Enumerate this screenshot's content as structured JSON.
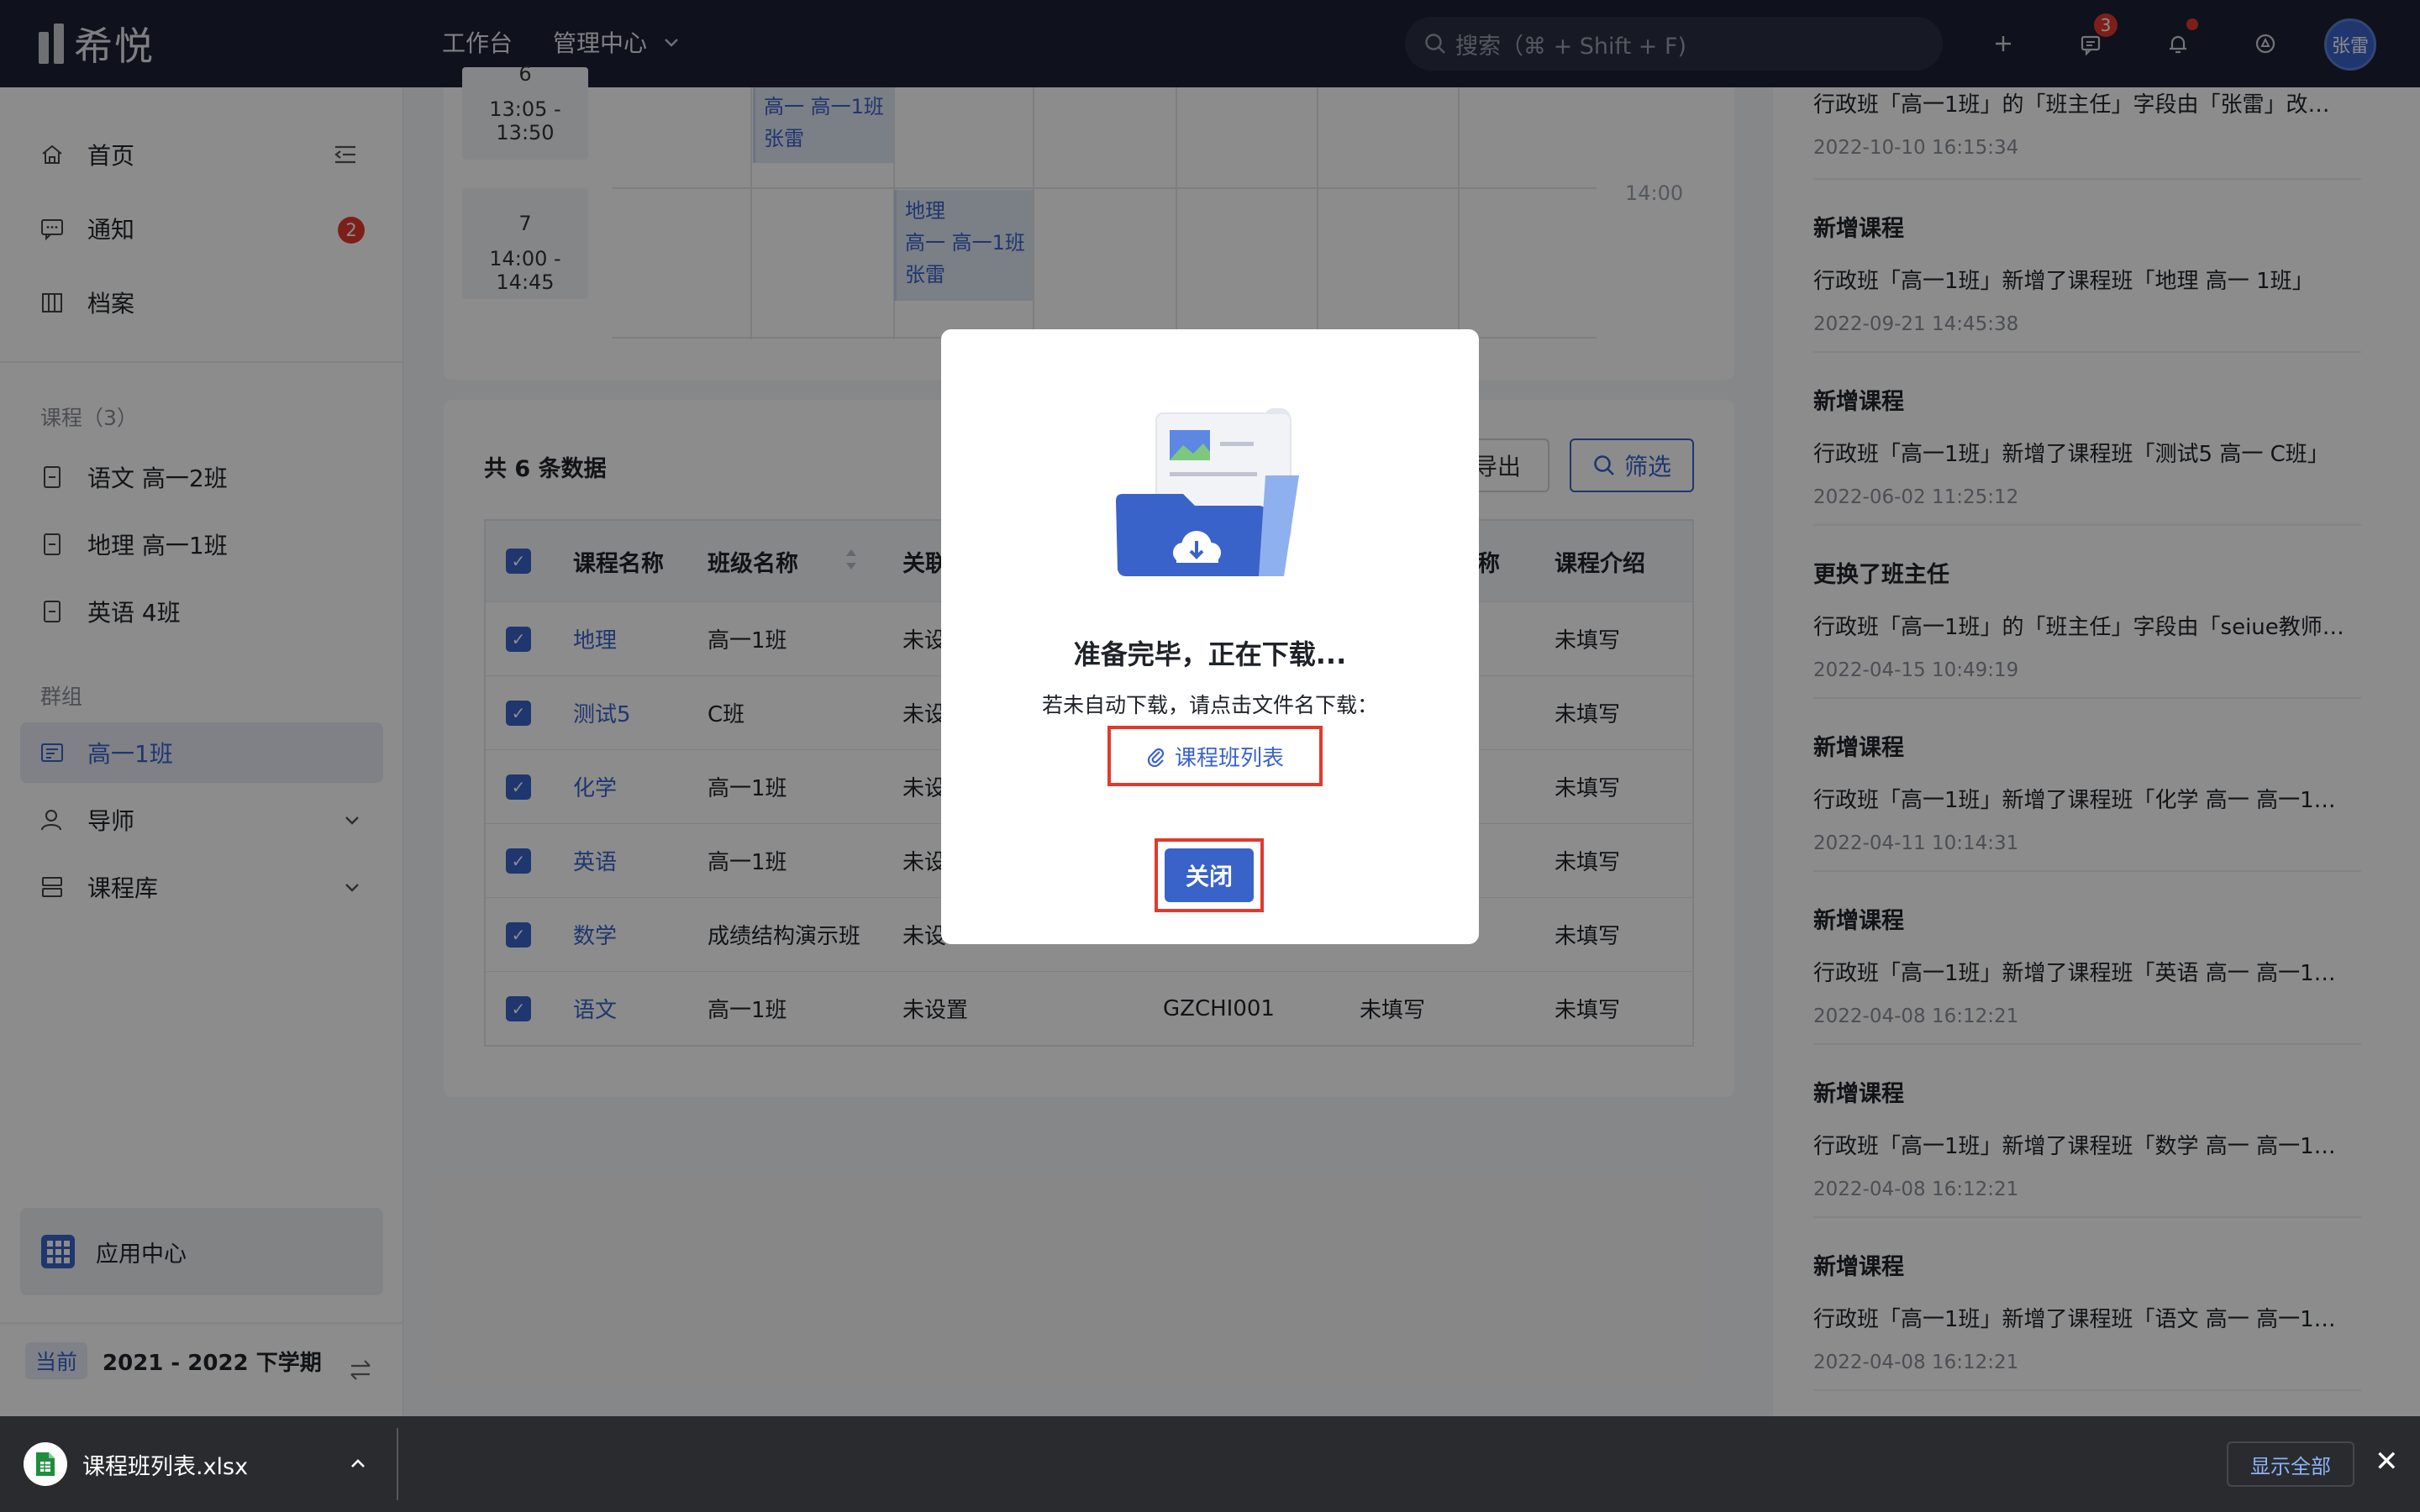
{
  "topbar": {
    "logo": "希悦",
    "nav": [
      "工作台",
      "管理中心"
    ],
    "search_placeholder": "搜索（⌘ + Shift + F)",
    "messages_badge": "3",
    "avatar": "张雷"
  },
  "sidebar": {
    "items": [
      {
        "label": "首页",
        "icon": "home-icon"
      },
      {
        "label": "通知",
        "icon": "chat-icon",
        "badge": "2"
      },
      {
        "label": "档案",
        "icon": "archive-icon"
      }
    ],
    "course_section": "课程（3）",
    "courses": [
      "语文 高一2班",
      "地理 高一1班",
      "英语 4班"
    ],
    "group_section": "群组",
    "groups": [
      {
        "label": "高一1班",
        "active": true
      },
      {
        "label": "导师"
      },
      {
        "label": "课程库"
      }
    ],
    "app_center": "应用中心",
    "term_tag": "当前",
    "term_label": "2021 - 2022 下学期"
  },
  "timetable": {
    "periods": [
      {
        "num": "6",
        "time": "13:05 - 13:50"
      },
      {
        "num": "7",
        "time": "14:00 - 14:45"
      }
    ],
    "time_marker": "14:00",
    "cells": [
      {
        "line1": "高一  高一1班",
        "line2": "张雷"
      },
      {
        "line0": "地理",
        "line1": "高一  高一1班",
        "line2": "张雷"
      }
    ]
  },
  "list": {
    "count": "共 6 条数据",
    "export_label": "导出",
    "filter_label": "筛选",
    "columns": [
      "课程名称",
      "班级名称",
      "关联",
      "",
      "称",
      "课程介绍"
    ],
    "rows": [
      {
        "name": "地理",
        "class": "高一1班",
        "rel": "未设",
        "code": "",
        "other": "",
        "intro": "未填写"
      },
      {
        "name": "测试5",
        "class": "C班",
        "rel": "未设",
        "code": "",
        "other": "",
        "intro": "未填写"
      },
      {
        "name": "化学",
        "class": "高一1班",
        "rel": "未设",
        "code": "",
        "other": "",
        "intro": "未填写"
      },
      {
        "name": "英语",
        "class": "高一1班",
        "rel": "未设",
        "code": "",
        "other": "",
        "intro": "未填写"
      },
      {
        "name": "数学",
        "class": "成绩结构演示班",
        "rel": "未设",
        "code": "",
        "other": "",
        "intro": "未填写"
      },
      {
        "name": "语文",
        "class": "高一1班",
        "rel": "未设置",
        "code": "GZCHI001",
        "other": "未填写",
        "intro": "未填写"
      }
    ]
  },
  "activity": [
    {
      "title": "",
      "desc": "行政班「高一1班」的「班主任」字段由「张雷」改为…",
      "time": "2022-10-10 16:15:34"
    },
    {
      "title": "新增课程",
      "desc": "行政班「高一1班」新增了课程班「地理 高一 1班」",
      "time": "2022-09-21 14:45:38"
    },
    {
      "title": "新增课程",
      "desc": "行政班「高一1班」新增了课程班「测试5 高一 C班」",
      "time": "2022-06-02 11:25:12"
    },
    {
      "title": "更换了班主任",
      "desc": "行政班「高一1班」的「班主任」字段由「seiue教师,…",
      "time": "2022-04-15 10:49:19"
    },
    {
      "title": "新增课程",
      "desc": "行政班「高一1班」新增了课程班「化学 高一 高一1…",
      "time": "2022-04-11 10:14:31"
    },
    {
      "title": "新增课程",
      "desc": "行政班「高一1班」新增了课程班「英语 高一 高一1…",
      "time": "2022-04-08 16:12:21"
    },
    {
      "title": "新增课程",
      "desc": "行政班「高一1班」新增了课程班「数学 高一 高一1…",
      "time": "2022-04-08 16:12:21"
    },
    {
      "title": "新增课程",
      "desc": "行政班「高一1班」新增了课程班「语文 高一 高一1…",
      "time": "2022-04-08 16:12:21"
    }
  ],
  "modal": {
    "title": "准备完毕，正在下载...",
    "desc": "若未自动下载，请点击文件名下载：",
    "file_link": "课程班列表",
    "close": "关闭"
  },
  "download_bar": {
    "file": "课程班列表.xlsx",
    "show_all": "显示全部"
  },
  "colors": {
    "accent": "#3a63c9",
    "topbar": "#1d2233",
    "highlight": "#e03a2c"
  }
}
